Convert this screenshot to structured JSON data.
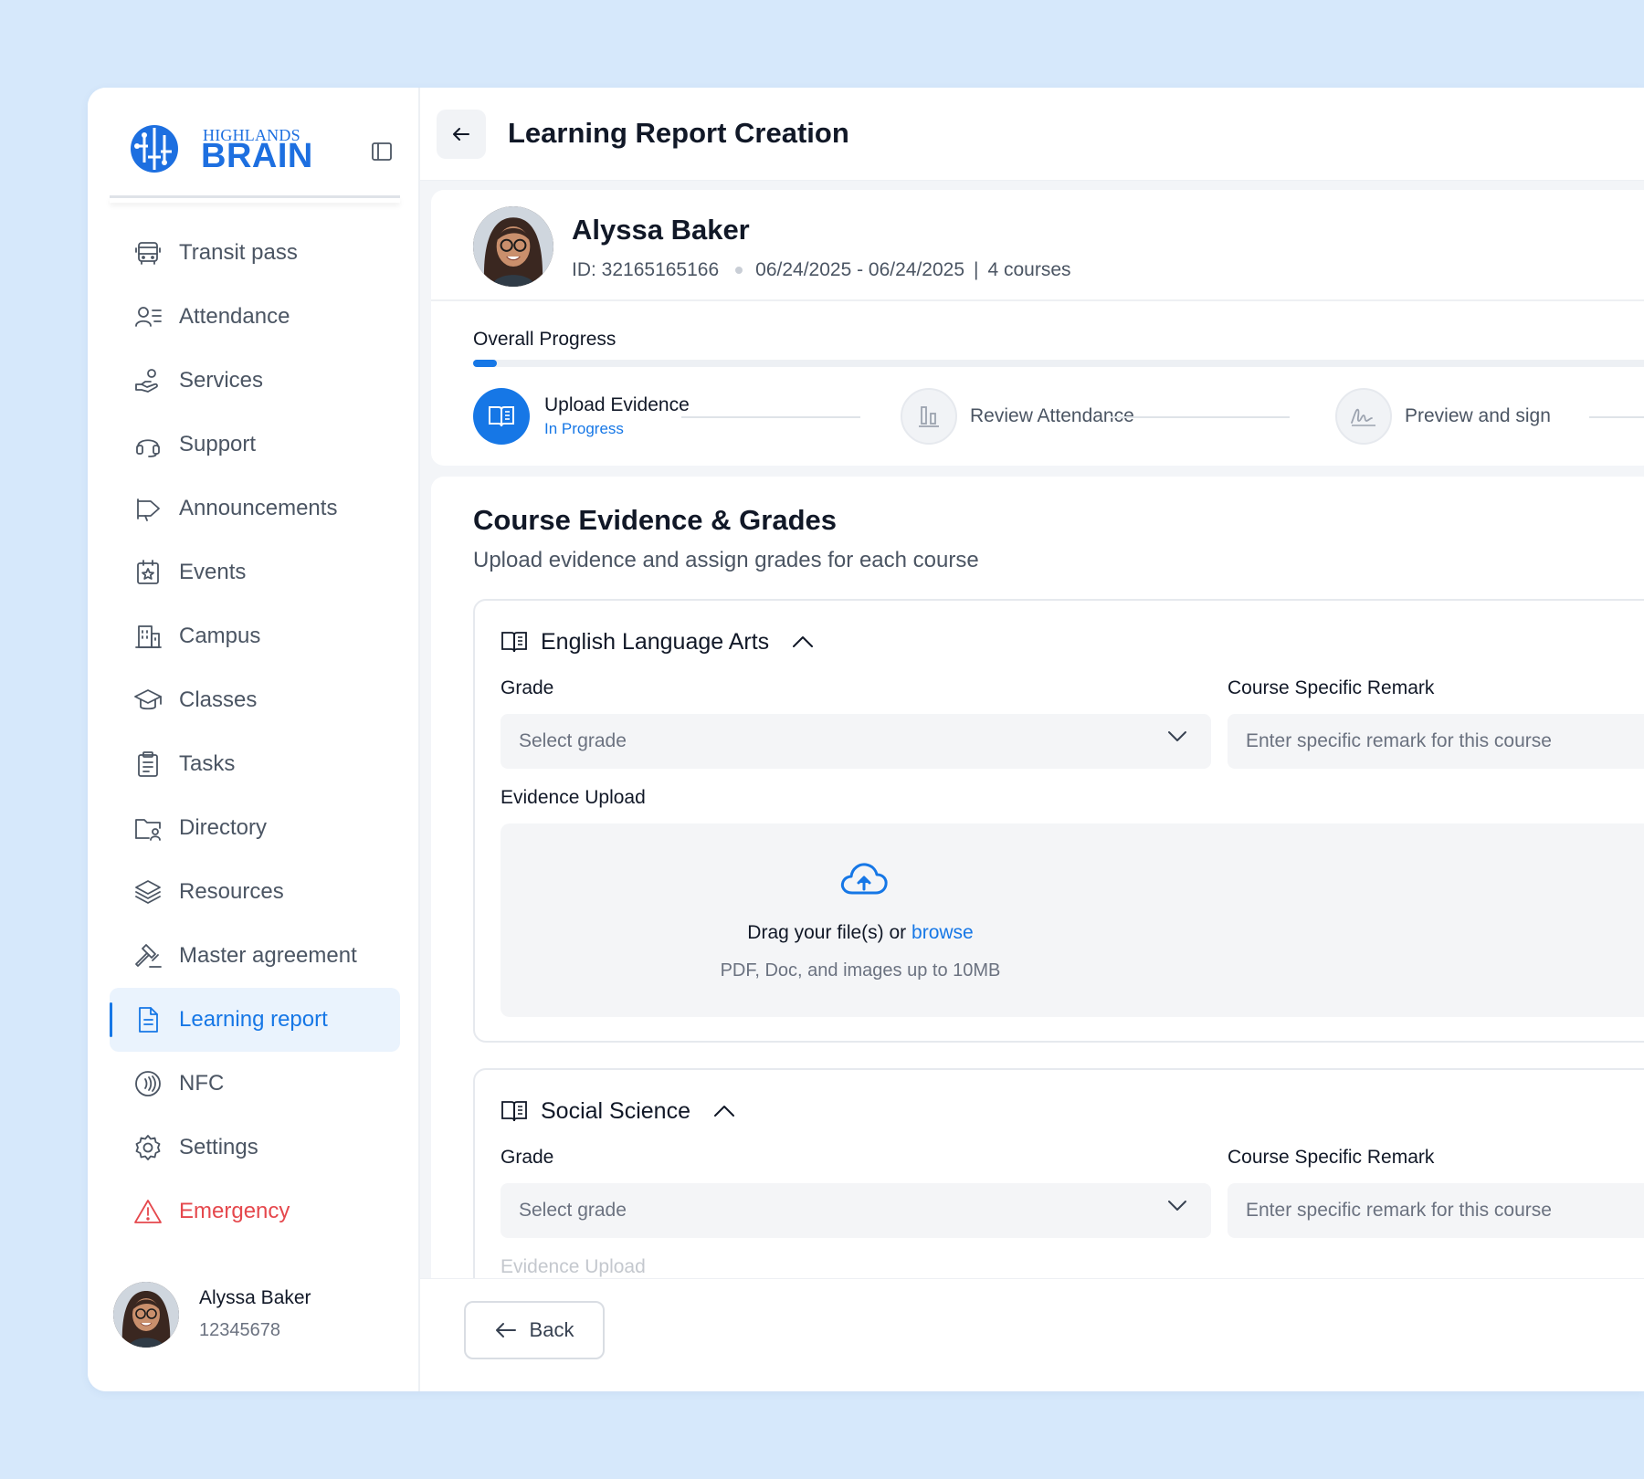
{
  "brand": {
    "logo_small": "HIGHLANDS",
    "logo_big": "BRAIN",
    "accent": "#1677e6",
    "danger": "#e5484d"
  },
  "sidebar": {
    "items": [
      {
        "label": "Transit pass",
        "icon": "bus-icon"
      },
      {
        "label": "Attendance",
        "icon": "user-list-icon"
      },
      {
        "label": "Services",
        "icon": "hand-coins-icon"
      },
      {
        "label": "Support",
        "icon": "headset-icon"
      },
      {
        "label": "Announcements",
        "icon": "megaphone-icon"
      },
      {
        "label": "Events",
        "icon": "calendar-star-icon"
      },
      {
        "label": "Campus",
        "icon": "building-icon"
      },
      {
        "label": "Classes",
        "icon": "graduation-cap-icon"
      },
      {
        "label": "Tasks",
        "icon": "clipboard-icon"
      },
      {
        "label": "Directory",
        "icon": "folder-user-icon"
      },
      {
        "label": "Resources",
        "icon": "layers-icon"
      },
      {
        "label": "Master agreement",
        "icon": "gavel-icon"
      },
      {
        "label": "Learning report",
        "icon": "document-icon",
        "active": true
      },
      {
        "label": "NFC",
        "icon": "nfc-icon"
      },
      {
        "label": "Settings",
        "icon": "gear-icon"
      },
      {
        "label": "Emergency",
        "icon": "warning-icon"
      }
    ],
    "user": {
      "name": "Alyssa Baker",
      "id": "12345678"
    }
  },
  "header": {
    "title": "Learning Report Creation"
  },
  "student": {
    "name": "Alyssa Baker",
    "id_text": "ID: 32165165166",
    "dates": "06/24/2025 - 06/24/2025",
    "separator": "|",
    "courses": "4 courses"
  },
  "progress": {
    "label": "Overall Progress",
    "fraction": 0.02,
    "steps": [
      {
        "title": "Upload Evidence",
        "status": "In Progress",
        "icon": "book-open-icon"
      },
      {
        "title": "Review Attendance",
        "icon": "bar-chart-icon"
      },
      {
        "title": "Preview and sign",
        "icon": "signature-icon"
      }
    ]
  },
  "evidence": {
    "title": "Course Evidence & Grades",
    "subtitle": "Upload evidence and assign grades for each course",
    "courses": [
      {
        "name": "English Language Arts",
        "grade_label": "Grade",
        "grade_placeholder": "Select grade",
        "remark_label": "Course Specific Remark",
        "remark_placeholder": "Enter specific remark for this course",
        "upload_label": "Evidence Upload",
        "drop_text": "Drag your file(s) or",
        "browse": "browse",
        "drop_hint": "PDF, Doc, and images up to 10MB"
      },
      {
        "name": "Social Science",
        "grade_label": "Grade",
        "grade_placeholder": "Select grade",
        "remark_label": "Course Specific Remark",
        "remark_placeholder": "Enter specific remark for this course",
        "upload_label": "Evidence Upload"
      }
    ]
  },
  "footer": {
    "back_label": "Back"
  }
}
